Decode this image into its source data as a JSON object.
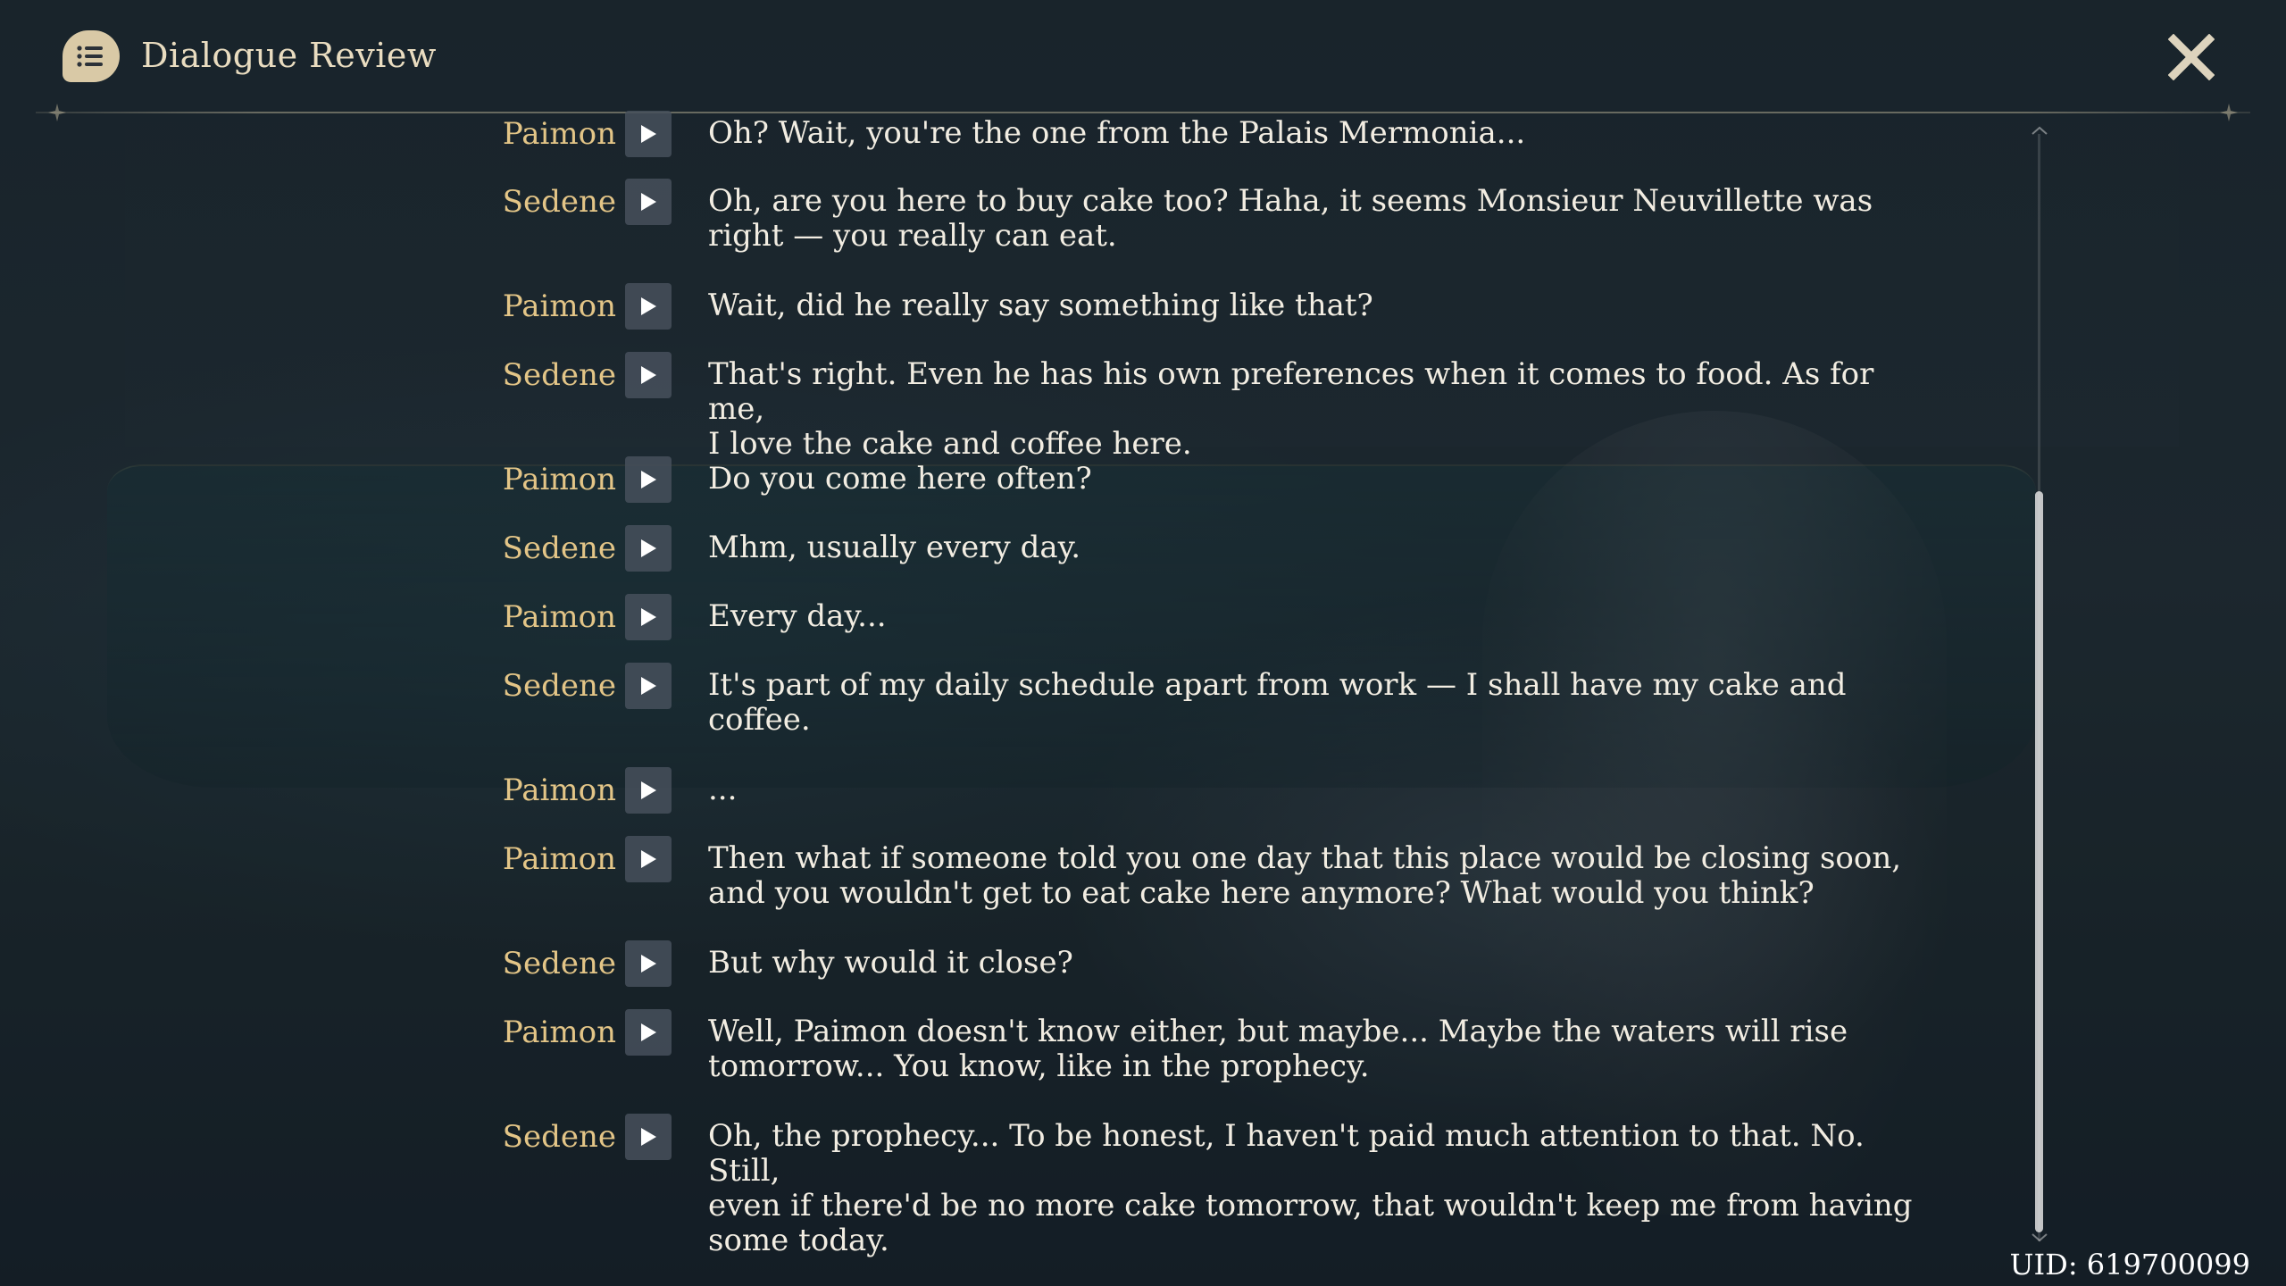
{
  "header": {
    "title": "Dialogue Review",
    "icon": "dialogue-list-icon",
    "close_icon": "close-icon"
  },
  "dialogue": [
    {
      "speaker": "Paimon",
      "text": "Oh? Wait, you're the one from the Palais Mermonia..."
    },
    {
      "speaker": "Sedene",
      "text": "Oh, are you here to buy cake too? Haha, it seems Monsieur Neuvillette was\nright — you really can eat."
    },
    {
      "speaker": "Paimon",
      "text": "Wait, did he really say something like that?"
    },
    {
      "speaker": "Sedene",
      "text": "That's right. Even he has his own preferences when it comes to food. As for me,\nI love the cake and coffee here."
    },
    {
      "speaker": "Paimon",
      "text": "Do you come here often?"
    },
    {
      "speaker": "Sedene",
      "text": "Mhm, usually every day."
    },
    {
      "speaker": "Paimon",
      "text": "Every day..."
    },
    {
      "speaker": "Sedene",
      "text": "It's part of my daily schedule apart from work — I shall have my cake and\ncoffee."
    },
    {
      "speaker": "Paimon",
      "text": "..."
    },
    {
      "speaker": "Paimon",
      "text": "Then what if someone told you one day that this place would be closing soon,\nand you wouldn't get to eat cake here anymore? What would you think?"
    },
    {
      "speaker": "Sedene",
      "text": "But why would it close?"
    },
    {
      "speaker": "Paimon",
      "text": "Well, Paimon doesn't know either, but maybe... Maybe the waters will rise\ntomorrow... You know, like in the prophecy."
    },
    {
      "speaker": "Sedene",
      "text": "Oh, the prophecy... To be honest, I haven't paid much attention to that. No. Still,\neven if there'd be no more cake tomorrow, that wouldn't keep me from having\nsome today."
    }
  ],
  "footer": {
    "uid": "UID: 619700099"
  },
  "colors": {
    "speaker": "#e3c587",
    "text": "#f2ede2",
    "title": "#e9dcc0"
  }
}
